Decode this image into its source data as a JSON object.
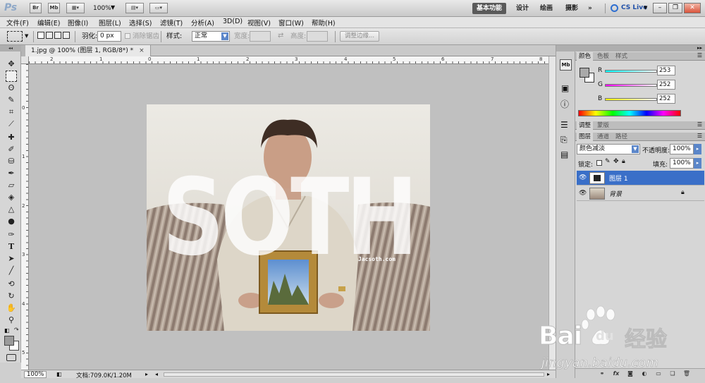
{
  "app": {
    "logo": "Ps",
    "bridge": "Br",
    "minibridge": "Mb",
    "zoom": "100%",
    "workspaces": [
      "基本功能",
      "设计",
      "绘画",
      "摄影"
    ],
    "more": "»",
    "cslive": "CS Live"
  },
  "menu": [
    "文件(F)",
    "编辑(E)",
    "图像(I)",
    "图层(L)",
    "选择(S)",
    "滤镜(T)",
    "分析(A)",
    "3D(D)",
    "视图(V)",
    "窗口(W)",
    "帮助(H)"
  ],
  "options": {
    "feather_label": "羽化:",
    "feather_value": "0 px",
    "antialias_label": "消除锯齿",
    "style_label": "样式:",
    "style_value": "正常",
    "width_label": "宽度:",
    "height_label": "高度:",
    "refine_edge": "调整边缘..."
  },
  "document": {
    "tab_title": "1.jpg @ 100% (图层 1, RGB/8*) *",
    "tab_close": "×",
    "ruler_h": [
      "2",
      "1",
      "0",
      "1",
      "2",
      "3",
      "4",
      "5",
      "6",
      "7",
      "8"
    ],
    "ruler_v": [
      "0",
      "1",
      "2",
      "3",
      "4",
      "5"
    ],
    "overlay_text": "SOTH",
    "overlay_url": "Jacsoth.com",
    "status_zoom": "100%",
    "status_doc": "文档:709.0K/1.20M"
  },
  "panels": {
    "color_tabs": [
      "颜色",
      "色板",
      "样式"
    ],
    "rgb": [
      {
        "label": "R",
        "value": "253"
      },
      {
        "label": "G",
        "value": "252"
      },
      {
        "label": "B",
        "value": "252"
      }
    ],
    "adjust_tabs": [
      "调整",
      "蒙版"
    ],
    "layer_tabs": [
      "图层",
      "通道",
      "路径"
    ],
    "blend_mode": "颜色减淡",
    "opacity_label": "不透明度:",
    "opacity_value": "100%",
    "lock_label": "锁定:",
    "fill_label": "填充:",
    "fill_value": "100%",
    "layers": [
      {
        "name": "图层 1",
        "selected": true
      },
      {
        "name": "背景",
        "selected": false,
        "locked": true
      }
    ],
    "side_icons": [
      "Mb"
    ]
  },
  "watermark": {
    "brand": "Bai",
    "brand2": "du",
    "cn": "经验",
    "url": "jingyan.baidu.com"
  },
  "colors": {
    "selected_layer": "#3a6fc8",
    "accent_blue": "#1f4fa8"
  }
}
